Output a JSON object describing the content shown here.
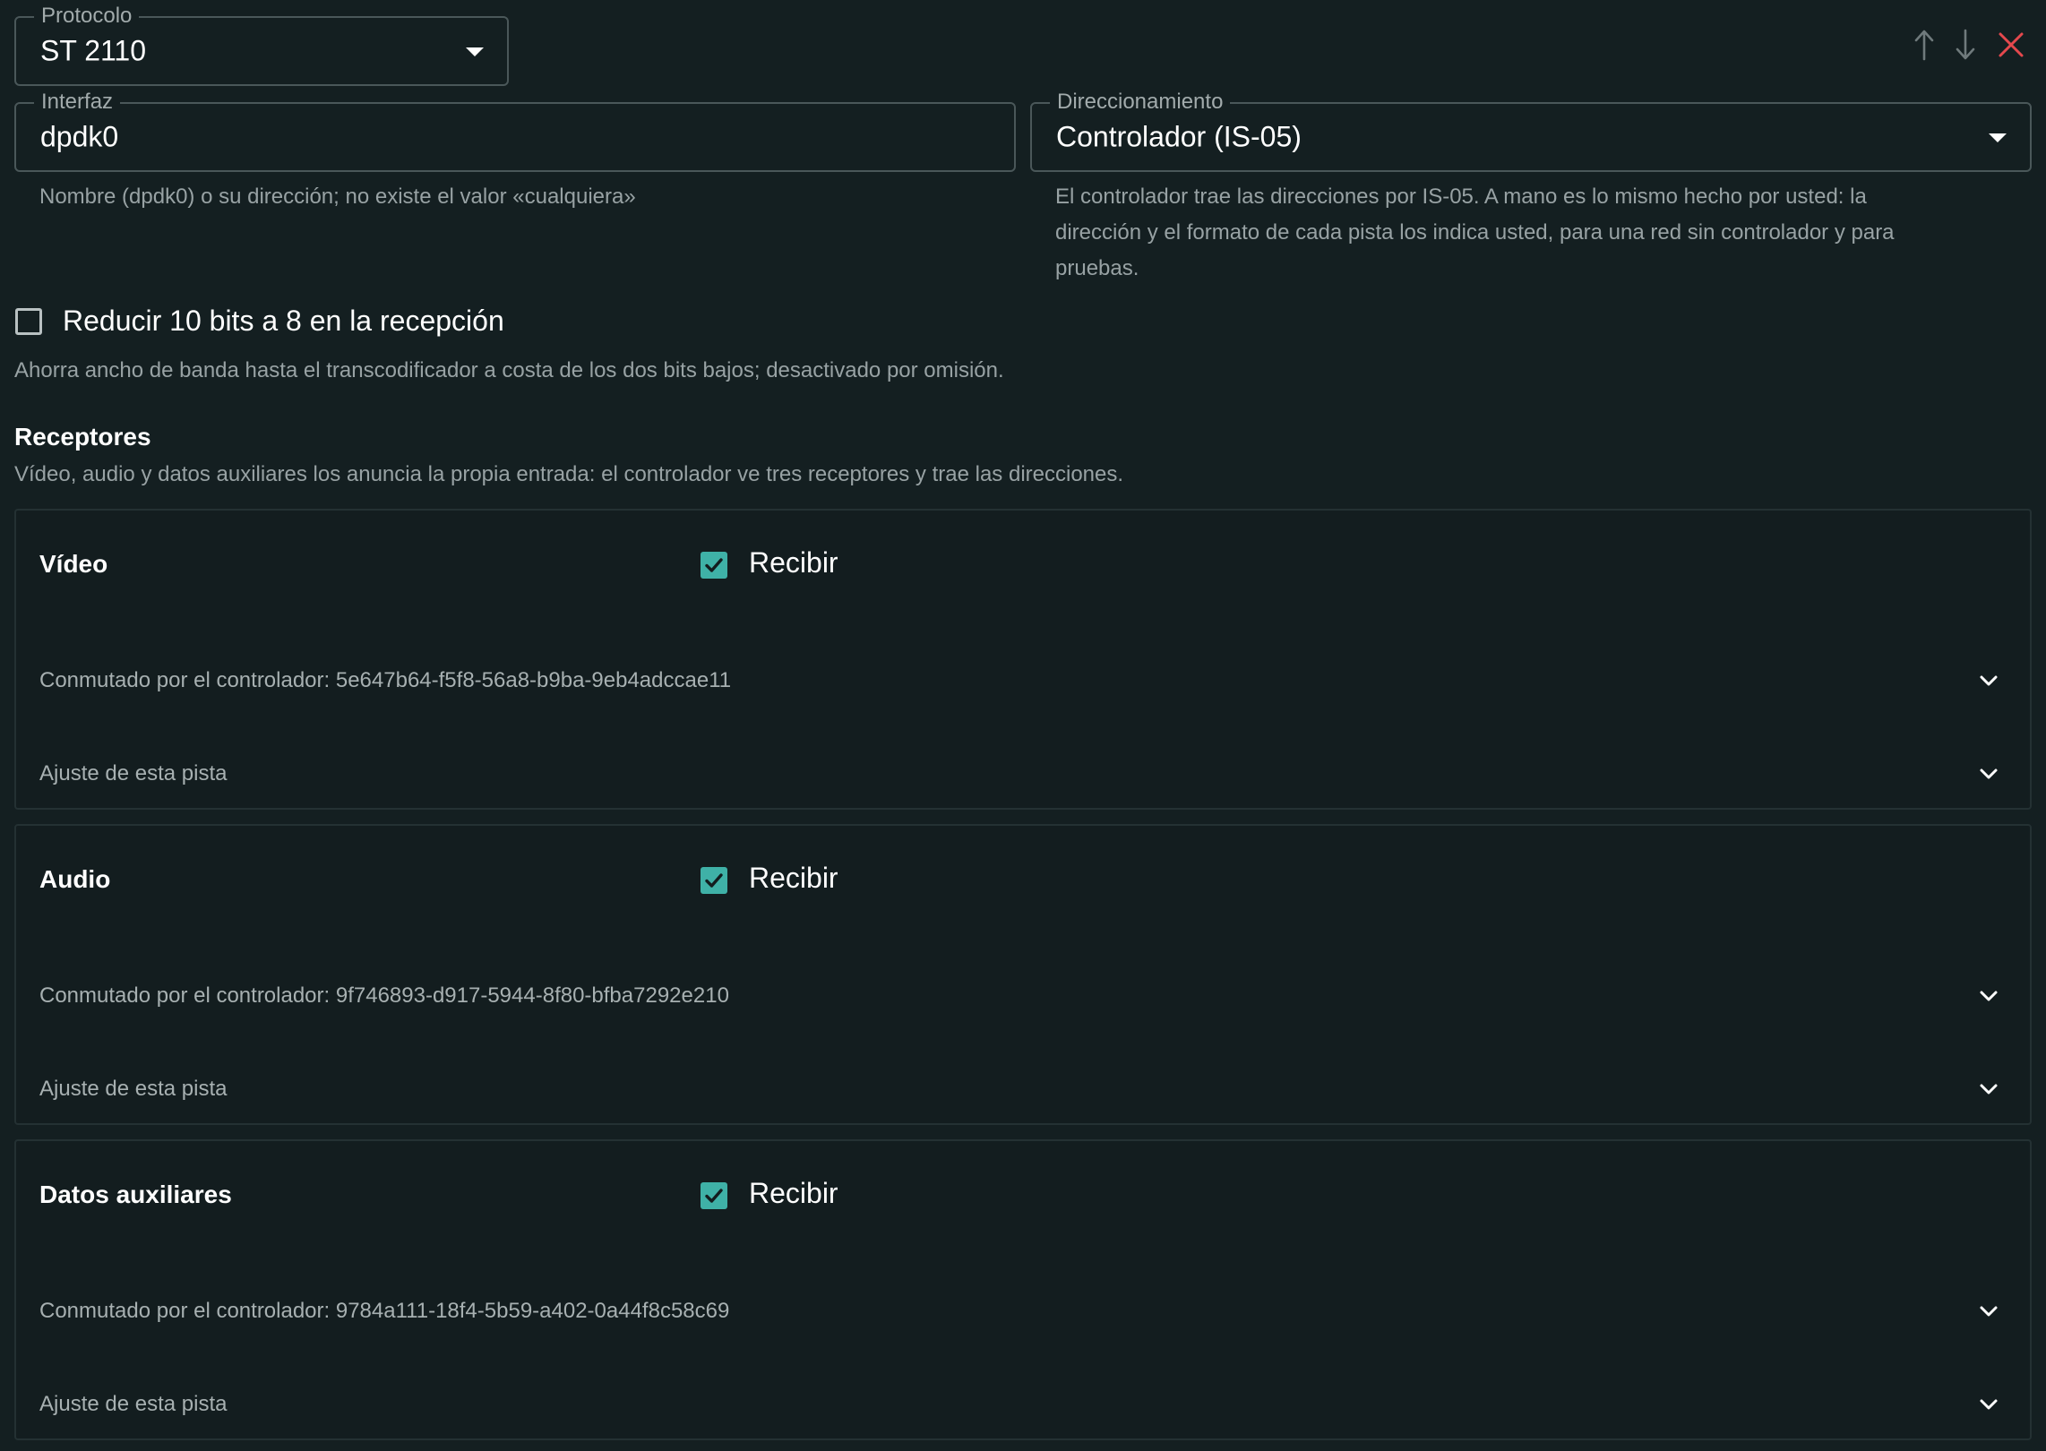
{
  "protocol": {
    "label": "Protocolo",
    "value": "ST 2110"
  },
  "interface": {
    "label": "Interfaz",
    "value": "dpdk0",
    "helper": "Nombre (dpdk0) o su dirección; no existe el valor «cualquiera»"
  },
  "addressing": {
    "label": "Direccionamiento",
    "value": "Controlador (IS-05)",
    "helper_lines": [
      "El controlador trae las direcciones por IS-05. A mano es lo mismo hecho por usted: la",
      "dirección y el formato de cada pista los indica usted, para una red sin controlador y para",
      "pruebas."
    ]
  },
  "toolbar": {
    "move_up_icon": "arrow-up-icon",
    "move_down_icon": "arrow-down-icon",
    "remove_icon": "close-icon",
    "accent_remove": "#e5484d"
  },
  "reduce_bits": {
    "label": "Reducir 10 bits a 8 en la recepción",
    "checked": false,
    "helper": "Ahorra ancho de banda hasta el transcodificador a costa de los dos bits bajos; desactivado por omisión."
  },
  "receivers": {
    "title": "Receptores",
    "description": "Vídeo, audio y datos auxiliares los anuncia la propia entrada: el controlador ve tres receptores y trae las direcciones.",
    "accent": "#3fb1a7",
    "items": [
      {
        "name": "Vídeo",
        "receive_label": "Recibir",
        "receive_checked": true,
        "switched_label": "Conmutado por el controlador: 5e647b64-f5f8-56a8-b9ba-9eb4adccae11",
        "adjust_label": "Ajuste de esta pista"
      },
      {
        "name": "Audio",
        "receive_label": "Recibir",
        "receive_checked": true,
        "switched_label": "Conmutado por el controlador: 9f746893-d917-5944-8f80-bfba7292e210",
        "adjust_label": "Ajuste de esta pista"
      },
      {
        "name": "Datos auxiliares",
        "receive_label": "Recibir",
        "receive_checked": true,
        "switched_label": "Conmutado por el controlador: 9784a111-18f4-5b59-a402-0a44f8c58c69",
        "adjust_label": "Ajuste de esta pista"
      }
    ]
  }
}
